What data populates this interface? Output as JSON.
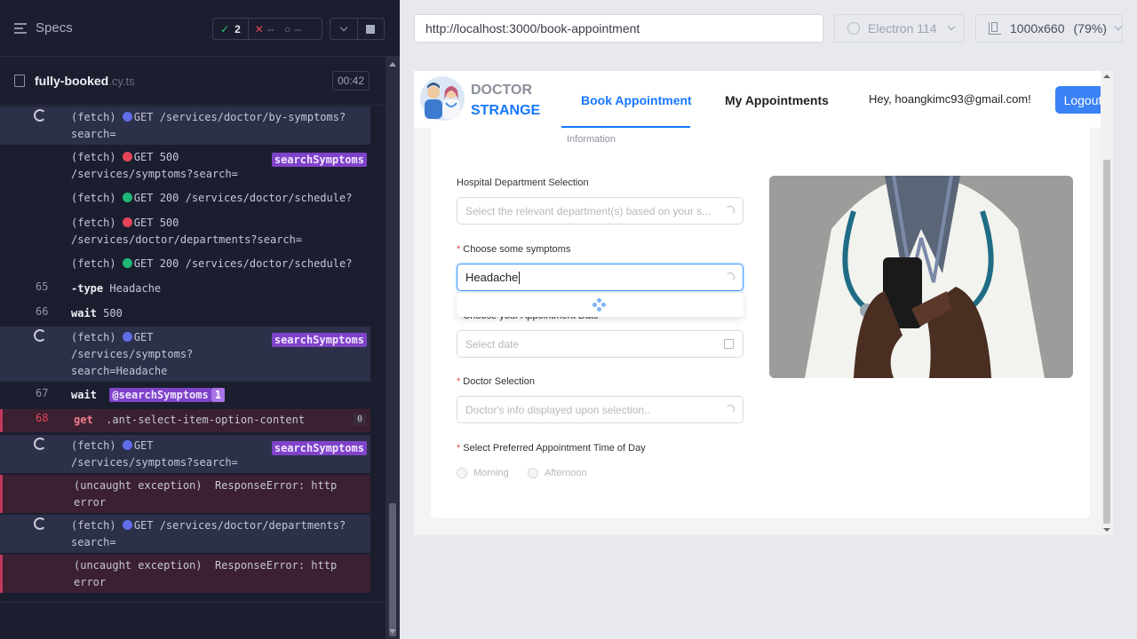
{
  "runner": {
    "specs_label": "Specs",
    "passed": "2",
    "failed": "--",
    "pending": "--",
    "spec_file": "fully-booked",
    "spec_ext": ".cy.ts",
    "duration": "00:42"
  },
  "log": {
    "r1": {
      "text": "(fetch) ",
      "method": "GET /services/doctor/by-symptoms?\nsearch="
    },
    "r2": {
      "text": "(fetch) ",
      "method": "GET 500\n/services/symptoms?search=",
      "tag": "searchSymptoms"
    },
    "r3": {
      "text": "(fetch) ",
      "method": "GET 200 /services/doctor/schedule?"
    },
    "r4": {
      "text": "(fetch) ",
      "method": "GET 500\n/services/doctor/departments?search="
    },
    "r5": {
      "text": "(fetch) ",
      "method": "GET 200 /services/doctor/schedule?"
    },
    "r6": {
      "num": "65",
      "cmd": "-type",
      "arg": "Headache"
    },
    "r7": {
      "num": "66",
      "cmd": "wait",
      "arg": "500"
    },
    "r8": {
      "text": "(fetch) ",
      "method": "GET\n/services/symptoms?\nsearch=Headache",
      "tag": "searchSymptoms"
    },
    "r9": {
      "num": "67",
      "cmd": "wait",
      "alias": "@searchSymptoms",
      "count": "1"
    },
    "r10": {
      "num": "68",
      "cmd": "get",
      "arg": ".ant-select-item-option-content",
      "count": "0"
    },
    "r11": {
      "text": "(fetch) ",
      "method": "GET\n/services/symptoms?search=",
      "tag": "searchSymptoms"
    },
    "r12": {
      "text": "(uncaught exception)  ResponseError: http\nerror"
    },
    "r13": {
      "text": "(fetch) ",
      "method": "GET /services/doctor/departments?\nsearch="
    },
    "r14": {
      "text": "(uncaught exception)  ResponseError: http\nerror"
    }
  },
  "aut": {
    "url": "http://localhost:3000/book-appointment",
    "browser": "Electron 114",
    "viewport": "1000x660",
    "scale": "(79%)"
  },
  "app": {
    "brand_top": "DOCTOR",
    "brand_bottom": "STRANGE",
    "nav_book": "Book Appointment",
    "nav_my": "My Appointments",
    "greeting": "Hey, hoangkimc93@gmail.com!",
    "logout": "Logout",
    "step1": "Information",
    "dept_label": "Hospital Department Selection",
    "dept_placeholder": "Select the relevant department(s) based on your s...",
    "symptoms_label": "Choose some symptoms",
    "symptoms_value": "Headache",
    "date_label": "Choose your Appointment Date",
    "date_placeholder": "Select date",
    "doctor_label": "Doctor Selection",
    "doctor_placeholder": "Doctor's info displayed upon selection..",
    "time_label": "Select Preferred Appointment Time of Day",
    "morning": "Morning",
    "afternoon": "Afternoon"
  },
  "colors": {
    "accent": "#1677ff",
    "logout_bg": "#3b82f6",
    "runner_bg": "#1b1e2e",
    "alias_tag": "#7f43c9",
    "error_row": "#3b2031"
  }
}
